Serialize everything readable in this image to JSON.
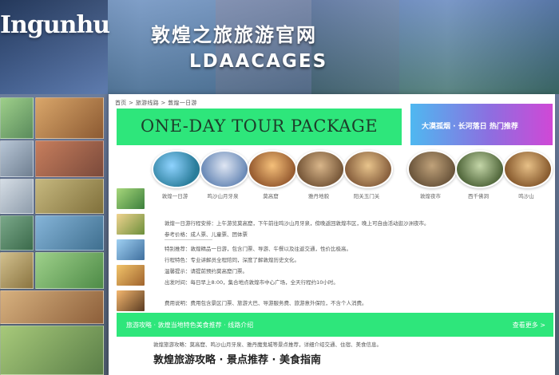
{
  "colors": {
    "accent_green": "#2ee67b",
    "promo_start": "#4fb8f0",
    "promo_end": "#d048d6",
    "banner_dark": "#2d3f63"
  },
  "header": {
    "brand": "Ingunhu",
    "title": "敦煌之旅旅游官网",
    "subtitle": "LDAACAGES"
  },
  "breadcrumb": "首页 > 旅游线路 > 敦煌一日游",
  "hero": {
    "title": "ONE-DAY TOUR PACKAGE"
  },
  "promo": {
    "label": "大漠孤烟 · 长河落日 热门推荐"
  },
  "thumbs": [
    {
      "label": "敦煌一日游",
      "icon": "lake-thumb"
    },
    {
      "label": "鸣沙山月牙泉",
      "icon": "dome-thumb"
    },
    {
      "label": "莫高窟",
      "icon": "temple-thumb"
    },
    {
      "label": "雅丹地貌",
      "icon": "village-thumb"
    },
    {
      "label": "阳关玉门关",
      "icon": "castle-thumb"
    },
    {
      "label": "敦煌夜市",
      "icon": "stone-thumb"
    },
    {
      "label": "西千佛洞",
      "icon": "mountain-thumb"
    },
    {
      "label": "鸣沙山",
      "icon": "desert-thumb"
    }
  ],
  "list_lines": [
    "敦煌一日游行程安排：上午游览莫高窟，下午前往鸣沙山月牙泉，傍晚返回敦煌市区，晚上可自由活动逛沙洲夜市。",
    "参考价格：成人票、儿童票、团体票",
    "特别推荐：敦煌精品一日游，包含门票、导游、午餐以及往返交通，性价比极高。",
    "行程特色：专业讲解员全程陪同，深度了解敦煌历史文化。",
    "温馨提示：请提前预约莫高窟门票。",
    "出发时间：每日早上8:00，集合地点敦煌市中心广场，全天行程约10小时。",
    "费用说明：费用包含景区门票、旅游大巴、导游服务费、旅游意外保险，不含个人消费。"
  ],
  "section": {
    "title": "旅游攻略 · 敦煌当地特色美食推荐 · 线路介绍",
    "more": "查看更多 >"
  },
  "bottom": {
    "top_line": "敦煌旅游攻略：莫高窟、鸣沙山月牙泉、雅丹魔鬼城等景点推荐，详细介绍交通、住宿、美食信息。",
    "headline": "敦煌旅游攻略 · 景点推荐 · 美食指南"
  }
}
